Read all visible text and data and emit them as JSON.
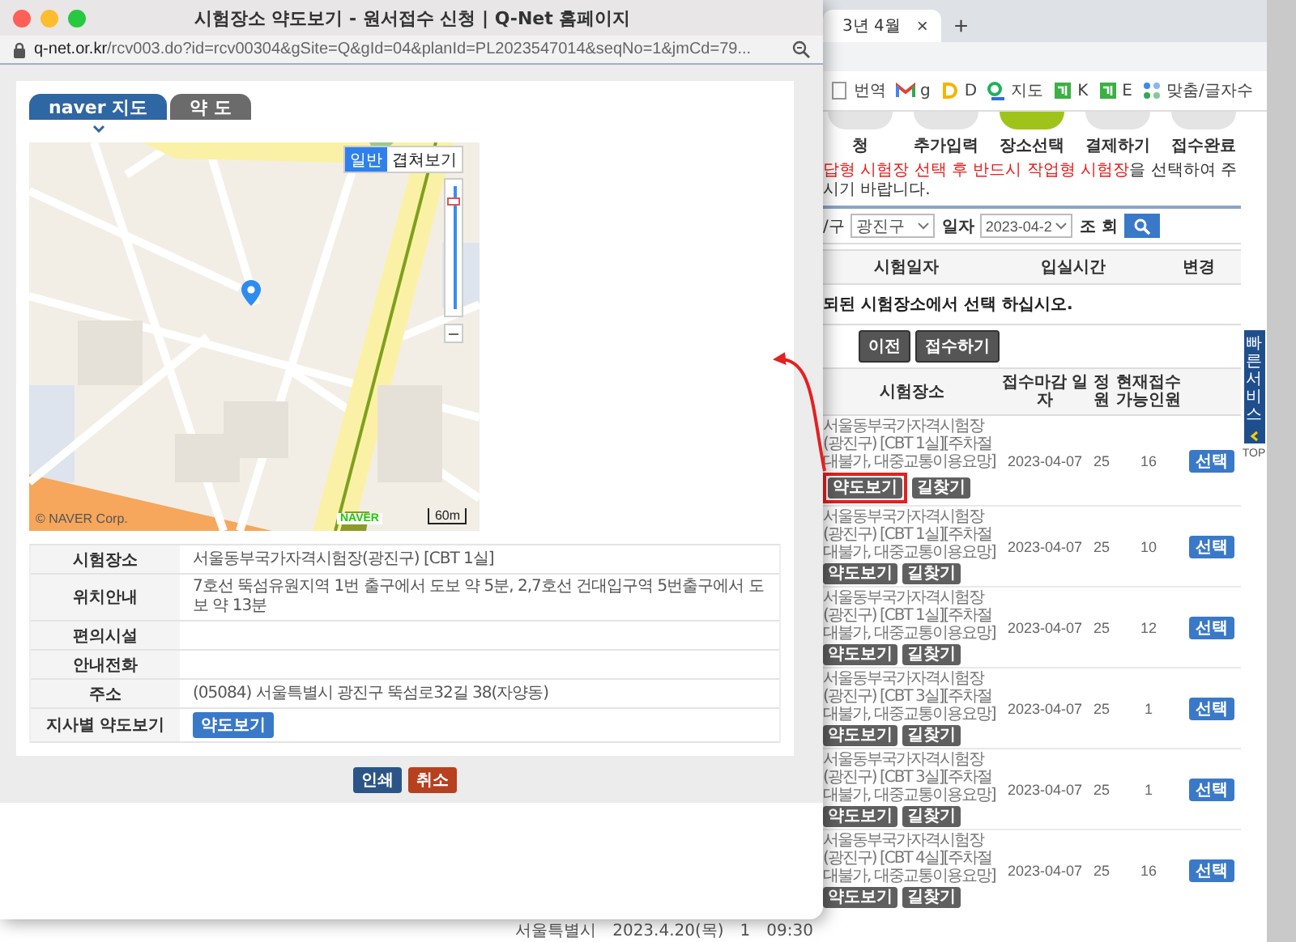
{
  "popup": {
    "title": "시험장소 약도보기 - 원서접수 신청 | Q-Net 홈페이지",
    "url_domain": "q-net.or.kr",
    "url_path": "/rcv003.do?id=rcv00304&gSite=Q&gId=04&planId=PL2023547014&seqNo=1&jmCd=79...",
    "tabs": [
      {
        "label": "naver 지도",
        "selected": true
      },
      {
        "label": "약 도",
        "selected": false
      }
    ],
    "map": {
      "map_types": [
        {
          "label": "일반",
          "selected": true
        },
        {
          "label": "겹쳐보기",
          "selected": false
        }
      ],
      "zoom": {
        "level": 0.9
      },
      "copyright": "© NAVER Corp.",
      "logo": "NAVER",
      "scale": "60m"
    },
    "info_rows": [
      {
        "kind": "text",
        "label": "시험장소",
        "value": "서울동부국가자격시험장(광진구) [CBT 1실]"
      },
      {
        "kind": "text",
        "label": "위치안내",
        "value": "7호선 뚝섬유원지역 1번 출구에서 도보 약 5분, 2,7호선 건대입구역 5번출구에서 도보 약 13분"
      },
      {
        "kind": "text",
        "label": "편의시설"
      },
      {
        "kind": "text",
        "label": "안내전화"
      },
      {
        "kind": "text",
        "label": "주소",
        "value": "(05084) 서울특별시 광진구 뚝섬로32길 38(자양동)"
      },
      {
        "kind": "button",
        "label": "지사별 약도보기",
        "value": "약도보기"
      }
    ],
    "buttons": [
      {
        "label": "인쇄",
        "kind": "primary"
      },
      {
        "label": "취소",
        "kind": "danger"
      }
    ]
  },
  "background": {
    "tab": {
      "title": "3년 4월",
      "close": "×"
    },
    "new_tab": "+",
    "bookmarks": [
      {
        "label": "번역",
        "kind": "page"
      },
      {
        "label": "g",
        "kind": "mail"
      },
      {
        "label": "D",
        "kind": "letter"
      },
      {
        "label": "지도",
        "kind": "pin"
      },
      {
        "label": "K",
        "kind": "square"
      },
      {
        "label": "E",
        "kind": "square"
      },
      {
        "label": "맞춤/글자수",
        "kind": "dots"
      }
    ],
    "steps": [
      {
        "label": "청",
        "selected": false
      },
      {
        "label": "추가입력",
        "selected": false
      },
      {
        "label": "장소선택",
        "selected": true
      },
      {
        "label": "결제하기",
        "selected": false
      },
      {
        "label": "접수완료",
        "selected": false
      }
    ],
    "notice": {
      "highlighted": "답형 시험장 선택 후 반드시 작업형 시험장",
      "rest": "을 선택하여 주시기 바랍니다."
    },
    "filter": {
      "region_label": "/구",
      "region": "광진구",
      "date_label": "일자",
      "date": "2023-04-2",
      "search_label": "조 회"
    },
    "schedule_columns": [
      "시험일자",
      "입실시간",
      "변경"
    ],
    "message": "되된 시험장소에서 선택 하십시오.",
    "actions": [
      "이전",
      "접수하기"
    ],
    "columns": [
      "시험장소",
      "접수마감 일자",
      "정원",
      "현재접수 가능인원"
    ],
    "rows": [
      {
        "place": "서울동부국가자격시험장(광진구) [CBT 1실][주차절대불가, 대중교통이용요망]",
        "deadline": "2023-04-07",
        "capacity": "25",
        "available": "16",
        "map_button": "약도보기",
        "route_button": "길찾기",
        "select_button": "선택",
        "highlighted": true
      },
      {
        "place": "서울동부국가자격시험장(광진구) [CBT 1실][주차절대불가, 대중교통이용요망]",
        "deadline": "2023-04-07",
        "capacity": "25",
        "available": "10",
        "map_button": "약도보기",
        "route_button": "길찾기",
        "select_button": "선택",
        "highlighted": false
      },
      {
        "place": "서울동부국가자격시험장(광진구) [CBT 1실][주차절대불가, 대중교통이용요망]",
        "deadline": "2023-04-07",
        "capacity": "25",
        "available": "12",
        "map_button": "약도보기",
        "route_button": "길찾기",
        "select_button": "선택",
        "highlighted": false
      },
      {
        "place": "서울동부국가자격시험장(광진구) [CBT 3실][주차절대불가, 대중교통이용요망]",
        "deadline": "2023-04-07",
        "capacity": "25",
        "available": "1",
        "map_button": "약도보기",
        "route_button": "길찾기",
        "select_button": "선택",
        "highlighted": false
      },
      {
        "place": "서울동부국가자격시험장(광진구) [CBT 3실][주차절대불가, 대중교통이용요망]",
        "deadline": "2023-04-07",
        "capacity": "25",
        "available": "1",
        "map_button": "약도보기",
        "route_button": "길찾기",
        "select_button": "선택",
        "highlighted": false
      },
      {
        "place": "서울동부국가자격시험장(광진구) [CBT 4실][주차절대불가, 대중교통이용요망]",
        "deadline": "2023-04-07",
        "capacity": "25",
        "available": "16",
        "map_button": "약도보기",
        "route_button": "길찾기",
        "select_button": "선택",
        "highlighted": false
      }
    ],
    "quick_service": {
      "label": "빠른서비스",
      "top": "TOP"
    },
    "summary_row": [
      "서울특별시",
      "2023.4.20(목)",
      "1",
      "09:30"
    ]
  }
}
